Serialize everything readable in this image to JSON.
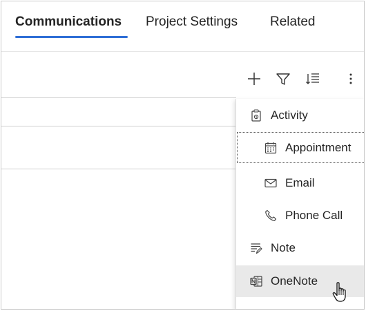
{
  "tabs": [
    {
      "label": "Communications",
      "active": true
    },
    {
      "label": "Project Settings",
      "active": false
    },
    {
      "label": "Related",
      "active": false
    }
  ],
  "toolbar": {
    "icons": [
      "plus-icon",
      "filter-icon",
      "sort-icon",
      "more-icon"
    ]
  },
  "menu": {
    "items": [
      {
        "label": "Activity",
        "icon": "activity-icon",
        "indent": false
      },
      {
        "label": "Appointment",
        "icon": "calendar-icon",
        "indent": true,
        "focused": true
      },
      {
        "label": "Email",
        "icon": "mail-icon",
        "indent": true
      },
      {
        "label": "Phone Call",
        "icon": "phone-icon",
        "indent": true
      },
      {
        "label": "Note",
        "icon": "note-icon",
        "indent": false
      },
      {
        "label": "OneNote",
        "icon": "onenote-icon",
        "indent": false,
        "hover": true
      }
    ]
  },
  "colors": {
    "accent": "#2f6fd6",
    "hover": "#e9e9e9"
  }
}
